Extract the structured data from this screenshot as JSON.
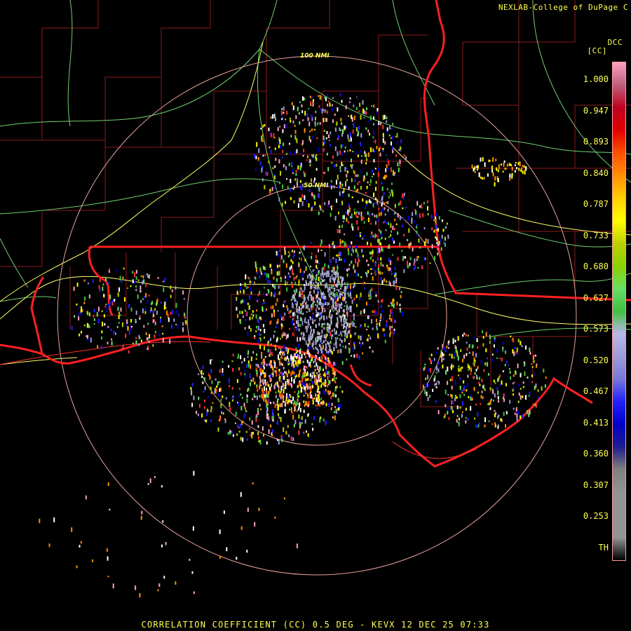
{
  "header": {
    "credit": "NEXLAB-College of DuPage C",
    "product_code": "DCC",
    "unit": "[CC]"
  },
  "ranges": [
    {
      "label": "50 NMI"
    },
    {
      "label": "100 NMI"
    }
  ],
  "colorbar": {
    "ticks": [
      "1.000",
      "0.947",
      "0.893",
      "0.840",
      "0.787",
      "0.733",
      "0.680",
      "0.627",
      "0.573",
      "0.520",
      "0.467",
      "0.413",
      "0.360",
      "0.307",
      "0.253",
      "TH"
    ],
    "colors": [
      "#000000",
      "#939393",
      "#939393",
      "#939393",
      "#808080",
      "#1f1f8e",
      "#0000c8",
      "#2020ff",
      "#7878d8",
      "#9c9cd8",
      "#b8b8e8",
      "#40c040",
      "#66e066",
      "#8ad000",
      "#bcd000",
      "#ffff00",
      "#ffd000",
      "#ff9000",
      "#ff5000",
      "#e00000",
      "#c00020",
      "#c06080",
      "#ffa0c0"
    ]
  },
  "footer": {
    "title": "CORRELATION COEFFICIENT (CC) 0.5 DEG - KEVX 12 DEC 25 07:33"
  }
}
